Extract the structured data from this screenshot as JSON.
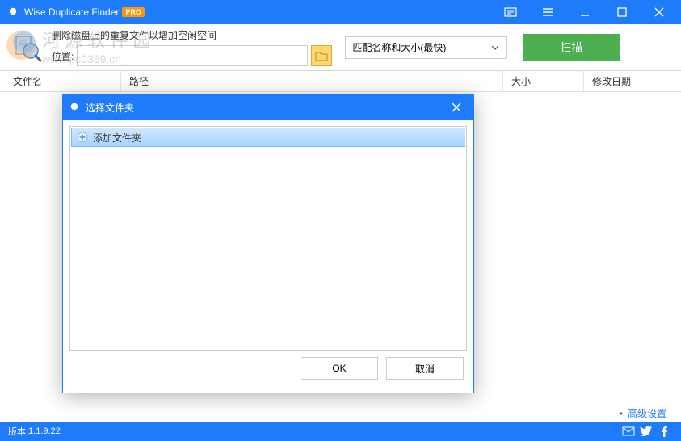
{
  "title": "Wise Duplicate Finder",
  "pro_badge": "PRO",
  "toolbar": {
    "description": "删除磁盘上的重复文件以增加空闲空间",
    "location_label": "位置:",
    "location_value": "",
    "match_selected": "匹配名称和大小(最快)",
    "scan_label": "扫描"
  },
  "table": {
    "col_name": "文件名",
    "col_path": "路径",
    "col_size": "大小",
    "col_date": "修改日期"
  },
  "footer": {
    "advanced_link": "高级设置"
  },
  "status": {
    "version_label": "版本:",
    "version": "1.1.9.22"
  },
  "dialog": {
    "title": "选择文件夹",
    "add_folder": "添加文件夹",
    "ok": "OK",
    "cancel": "取消"
  },
  "watermark": {
    "line1": "河 源 软 件 园",
    "line2": "www.pc0359.cn"
  }
}
